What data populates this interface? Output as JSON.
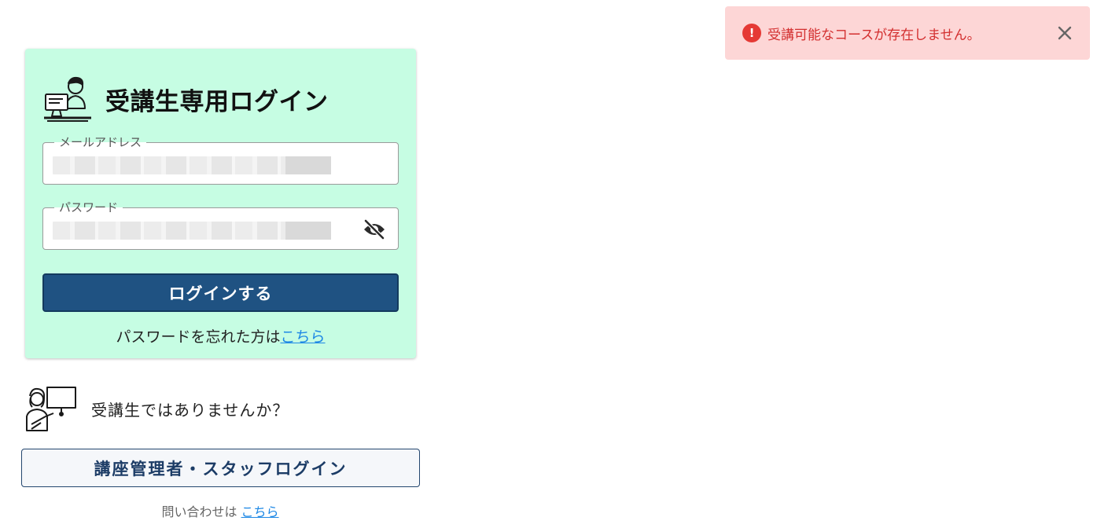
{
  "toast": {
    "message": "受講可能なコースが存在しません。",
    "type": "error",
    "icon": "error-circle-icon",
    "close_icon": "close-icon",
    "color": "#d32f2f",
    "background": "#fdd6d6"
  },
  "login_card": {
    "title": "受講生専用ログイン",
    "icon": "student-computer-icon",
    "background": "#c6fde3",
    "email": {
      "label": "メールアドレス",
      "value": ""
    },
    "password": {
      "label": "パスワード",
      "value": "",
      "toggle_icon": "eye-off-icon"
    },
    "submit_label": "ログインする",
    "submit_color": "#1f5282",
    "forgot_text": "パスワードを忘れた方は",
    "forgot_link": "こちら"
  },
  "staff": {
    "icon": "teacher-presentation-icon",
    "question": "受講生ではありませんか？",
    "button_label": "講座管理者・スタッフログイン"
  },
  "contact": {
    "text": "問い合わせは ",
    "link": "こちら"
  }
}
